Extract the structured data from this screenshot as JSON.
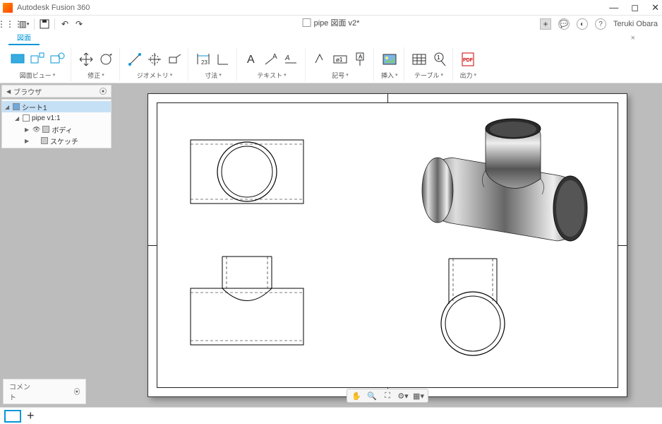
{
  "app": {
    "title": "Autodesk Fusion 360"
  },
  "document": {
    "tab_label": "pipe 図面 v2*",
    "unsaved": true
  },
  "user": {
    "name": "Teruki Obara"
  },
  "workspace_tab": {
    "label": "図面"
  },
  "ribbon": {
    "groups": [
      {
        "label": "図面ビュー"
      },
      {
        "label": "修正"
      },
      {
        "label": "ジオメトリ"
      },
      {
        "label": "寸法"
      },
      {
        "label": "テキスト"
      },
      {
        "label": "記号"
      },
      {
        "label": "挿入"
      },
      {
        "label": "テーブル"
      },
      {
        "label": "出力"
      }
    ]
  },
  "browser": {
    "title": "ブラウザ",
    "items": [
      {
        "label": "シート1",
        "level": 0,
        "selected": true
      },
      {
        "label": "pipe v1:1",
        "level": 1
      },
      {
        "label": "ボディ",
        "level": 2
      },
      {
        "label": "スケッチ",
        "level": 2
      }
    ]
  },
  "comment": {
    "label": "コメント"
  },
  "quick_access": {
    "icons": [
      "grid-menu",
      "file-menu",
      "save",
      "undo",
      "redo"
    ]
  },
  "header_right": {
    "icons": [
      "new-design",
      "comment",
      "extensions",
      "help"
    ]
  },
  "view_controls": {
    "icons": [
      "pan",
      "zoom-window",
      "zoom-fit",
      "display-settings",
      "grid"
    ]
  }
}
